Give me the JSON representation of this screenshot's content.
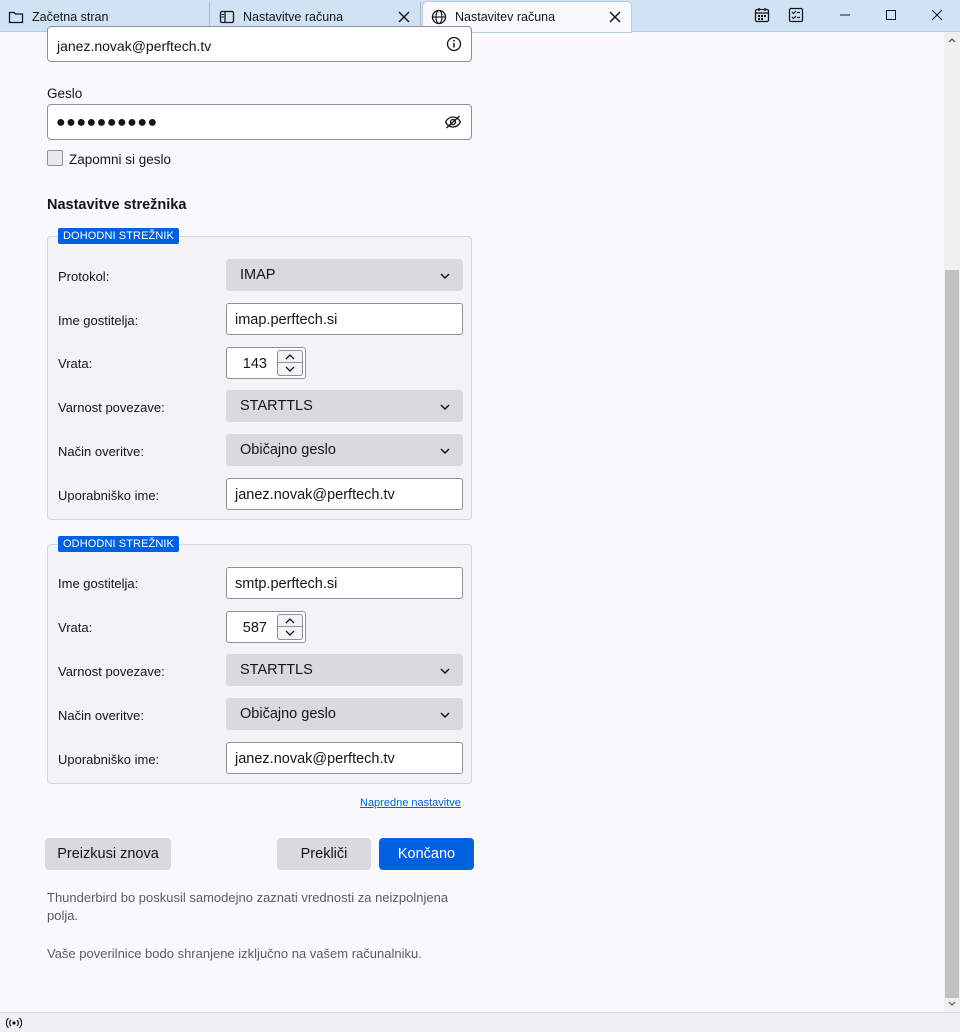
{
  "tabs": [
    {
      "label": "Začetna stran",
      "icon": "folder-icon"
    },
    {
      "label": "Nastavitve računa",
      "icon": "settings-page-icon"
    },
    {
      "label": "Nastavitev računa",
      "icon": "globe-icon"
    }
  ],
  "window_controls": {
    "calendar": "calendar-icon",
    "tasks": "tasks-icon",
    "minimize": "minimize-icon",
    "maximize": "maximize-icon",
    "close": "close-icon"
  },
  "account": {
    "email_value": "janez.novak@perftech.tv",
    "password_label": "Geslo",
    "password_value": "●●●●●●●●●●",
    "remember_label": "Zapomni si geslo"
  },
  "server_settings": {
    "title": "Nastavitve strežnika",
    "incoming": {
      "legend": "DOHODNI STREŽNIK",
      "protocol_label": "Protokol:",
      "protocol_value": "IMAP",
      "hostname_label": "Ime gostitelja:",
      "hostname_value": "imap.perftech.si",
      "port_label": "Vrata:",
      "port_value": "143",
      "security_label": "Varnost povezave:",
      "security_value": "STARTTLS",
      "auth_label": "Način overitve:",
      "auth_value": "Običajno geslo",
      "username_label": "Uporabniško ime:",
      "username_value": "janez.novak@perftech.tv"
    },
    "outgoing": {
      "legend": "ODHODNI STREŽNIK",
      "hostname_label": "Ime gostitelja:",
      "hostname_value": "smtp.perftech.si",
      "port_label": "Vrata:",
      "port_value": "587",
      "security_label": "Varnost povezave:",
      "security_value": "STARTTLS",
      "auth_label": "Način overitve:",
      "auth_value": "Običajno geslo",
      "username_label": "Uporabniško ime:",
      "username_value": "janez.novak@perftech.tv"
    }
  },
  "advanced_link": "Napredne nastavitve",
  "buttons": {
    "retest": "Preizkusi znova",
    "cancel": "Prekliči",
    "done": "Končano"
  },
  "notes": [
    "Thunderbird bo poskusil samodejno zaznati vrednosti za neizpolnjena polja.",
    "Vaše poverilnice bodo shranjene izključno na vašem računalniku."
  ],
  "colors": {
    "accent": "#0061e0",
    "tabbar": "#cfe3f4"
  }
}
